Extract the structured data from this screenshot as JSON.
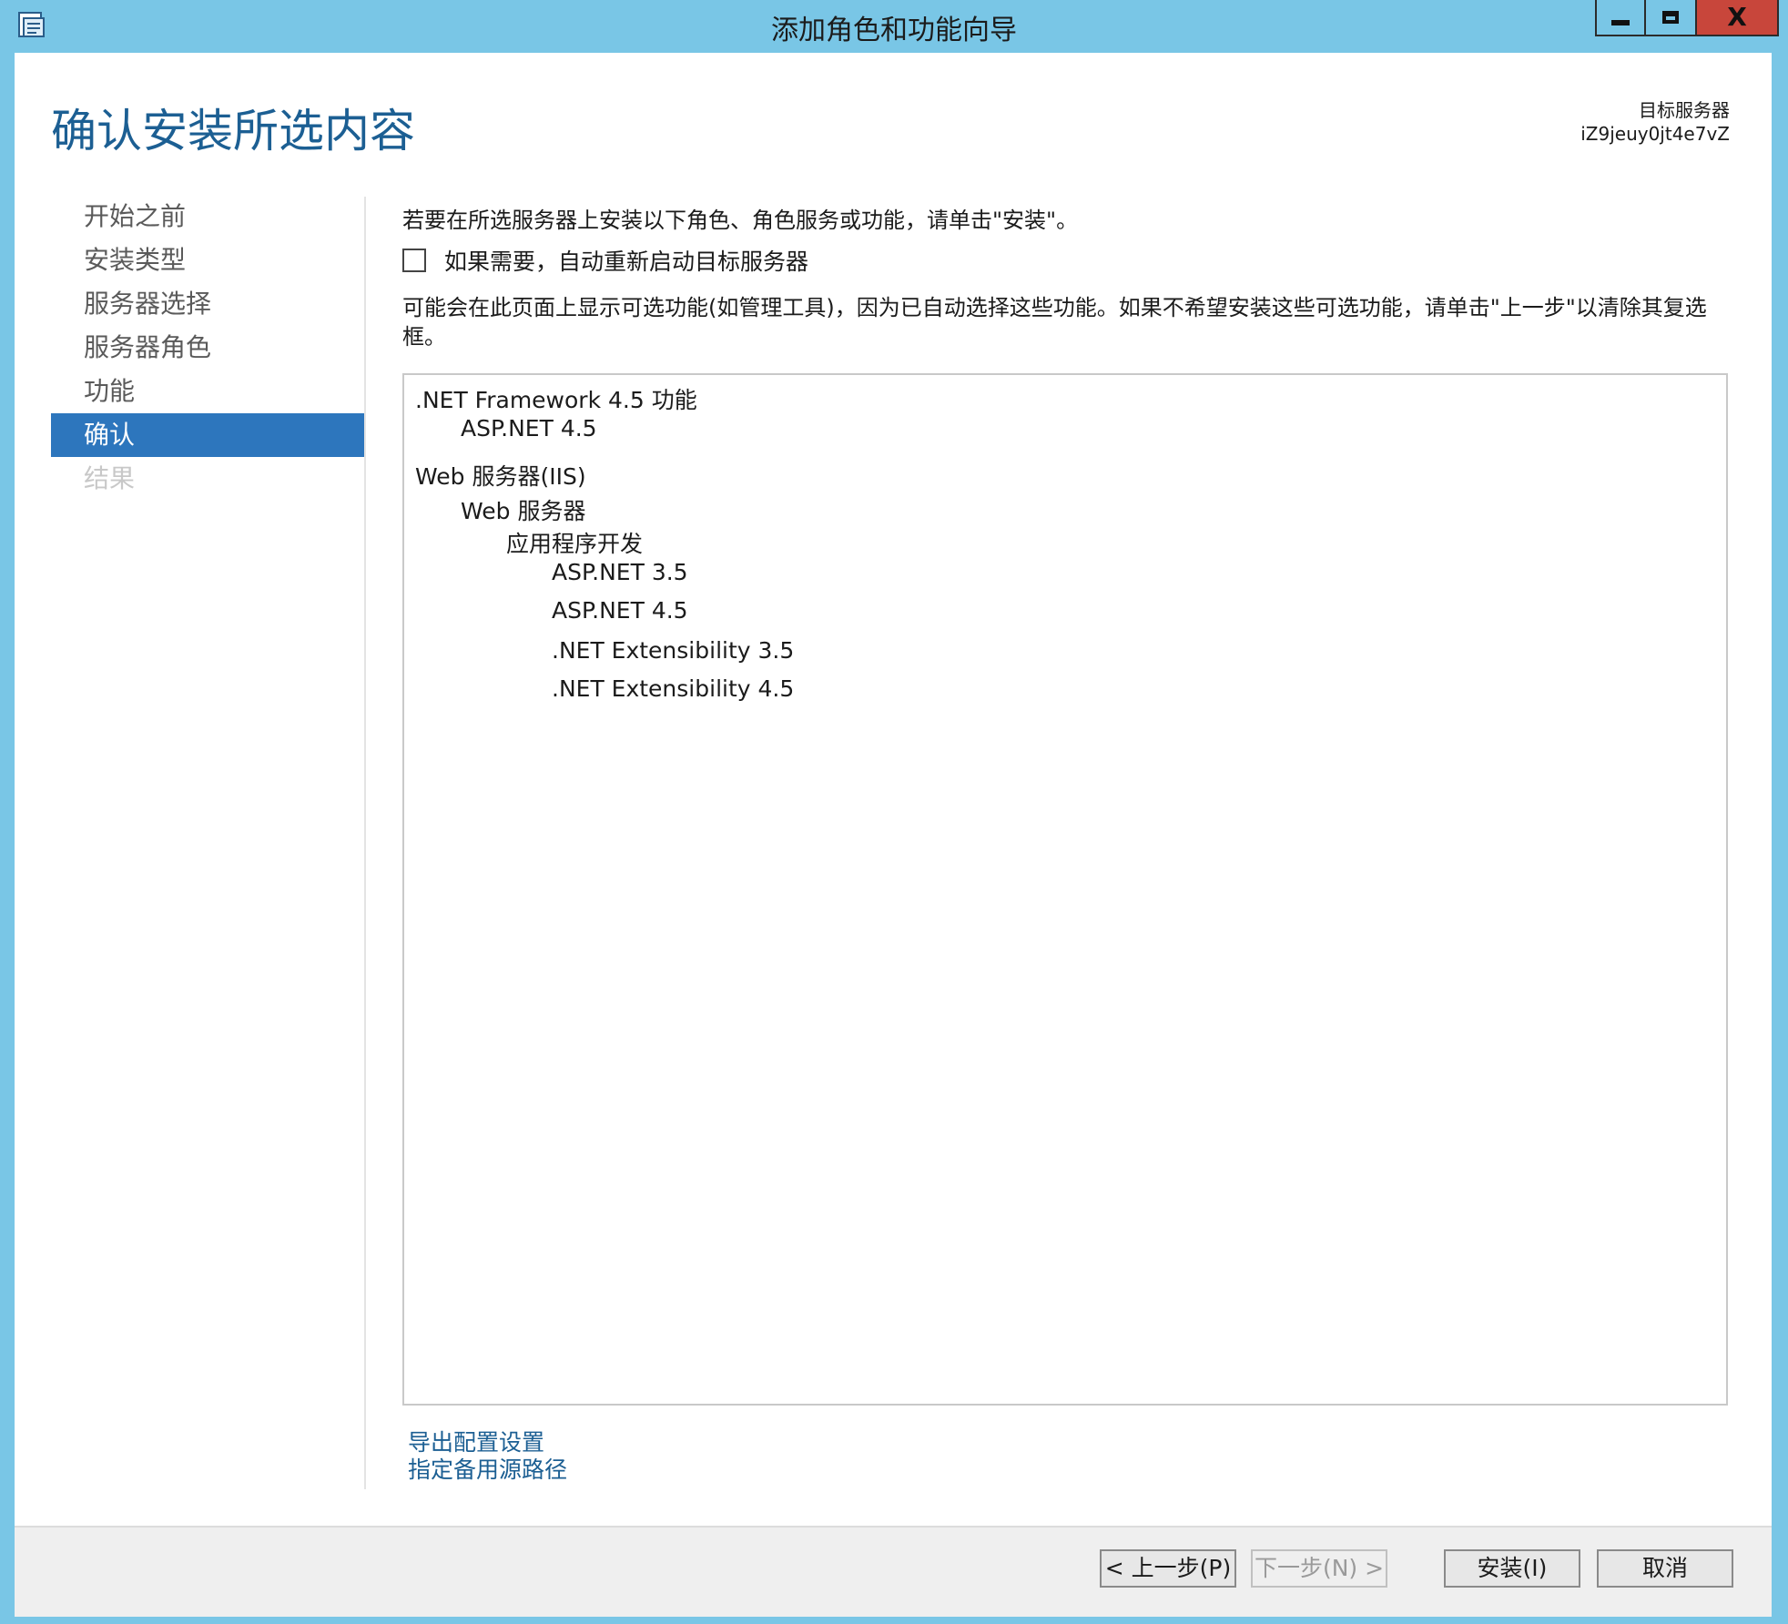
{
  "window": {
    "title": "添加角色和功能向导",
    "controls": {
      "minimize": "minimize",
      "maximize": "maximize",
      "close": "X"
    }
  },
  "header": {
    "page_title": "确认安装所选内容",
    "target_label": "目标服务器",
    "target_value": "iZ9jeuy0jt4e7vZ"
  },
  "nav": {
    "items": [
      {
        "label": "开始之前",
        "state": "normal"
      },
      {
        "label": "安装类型",
        "state": "normal"
      },
      {
        "label": "服务器选择",
        "state": "normal"
      },
      {
        "label": "服务器角色",
        "state": "normal"
      },
      {
        "label": "功能",
        "state": "normal"
      },
      {
        "label": "确认",
        "state": "active"
      },
      {
        "label": "结果",
        "state": "disabled"
      }
    ]
  },
  "content": {
    "intro": "若要在所选服务器上安装以下角色、角色服务或功能，请单击\"安装\"。",
    "restart_checkbox": {
      "label": "如果需要，自动重新启动目标服务器",
      "checked": false
    },
    "note": "可能会在此页面上显示可选功能(如管理工具)，因为已自动选择这些功能。如果不希望安装这些可选功能，请单击\"上一步\"以清除其复选框。",
    "selection_list": [
      ".NET Framework 4.5 功能",
      "ASP.NET 4.5",
      "Web 服务器(IIS)",
      "Web 服务器",
      "应用程序开发",
      "ASP.NET 3.5",
      "ASP.NET 4.5",
      ".NET Extensibility 3.5",
      ".NET Extensibility 4.5"
    ],
    "links": {
      "export": "导出配置设置",
      "alternate_source": "指定备用源路径"
    }
  },
  "footer": {
    "prev": "< 上一步(P)",
    "next": "下一步(N) >",
    "install": "安装(I)",
    "cancel": "取消"
  },
  "colors": {
    "titlebar": "#79c6e6",
    "accent": "#2d76bd",
    "heading": "#1c5f93",
    "close": "#c8463b"
  }
}
